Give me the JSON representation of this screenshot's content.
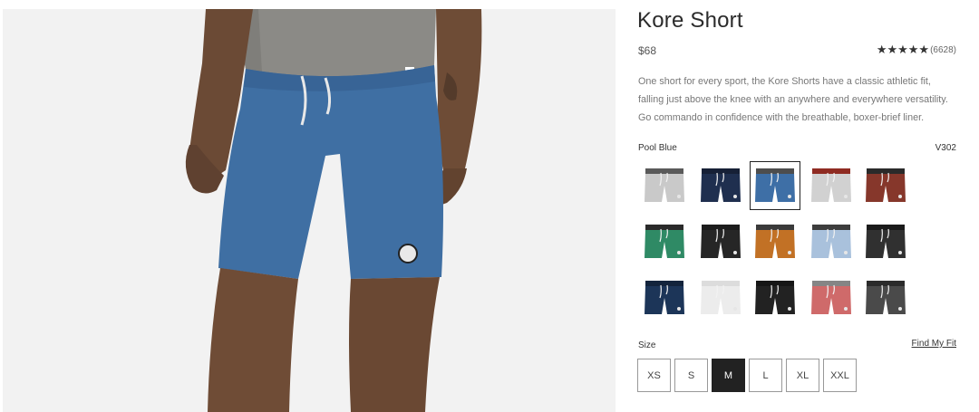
{
  "product": {
    "title": "Kore Short",
    "price": "$68",
    "rating_stars": "★★★★★",
    "review_count": "(6628)",
    "description": [
      "One short for every sport, the Kore Shorts have a classic athletic fit,",
      "falling just above the knee with an anywhere and everywhere versatility.",
      "Go commando in confidence with the breathable, boxer-brief liner."
    ]
  },
  "color": {
    "selected_name": "Pool Blue",
    "sku": "V302",
    "swatches": [
      {
        "name": "heather-grey",
        "body": "#c9c9c9",
        "band": "#5a5a5a",
        "selected": false
      },
      {
        "name": "navy-camo",
        "body": "#1f2f4f",
        "band": "#162036",
        "selected": false
      },
      {
        "name": "pool-blue",
        "body": "#3e6fa6",
        "band": "#4d4d4d",
        "selected": true
      },
      {
        "name": "grey-red-band",
        "body": "#d1d1d1",
        "band": "#8f2b22",
        "selected": false
      },
      {
        "name": "brick",
        "body": "#86372b",
        "band": "#2a2a2a",
        "selected": false
      },
      {
        "name": "green",
        "body": "#2f8a65",
        "band": "#2a2a2a",
        "selected": false
      },
      {
        "name": "black",
        "body": "#262626",
        "band": "#1c1c1c",
        "selected": false
      },
      {
        "name": "rust",
        "body": "#c27125",
        "band": "#3a3a3a",
        "selected": false
      },
      {
        "name": "light-blue",
        "body": "#a9c1dc",
        "band": "#3d3d3d",
        "selected": false
      },
      {
        "name": "black-print",
        "body": "#303030",
        "band": "#1a1a1a",
        "selected": false
      },
      {
        "name": "deep-navy",
        "body": "#1c3558",
        "band": "#13243c",
        "selected": false
      },
      {
        "name": "white",
        "body": "#ececec",
        "band": "#dcdcdc",
        "selected": false
      },
      {
        "name": "black-2",
        "body": "#222222",
        "band": "#161616",
        "selected": false
      },
      {
        "name": "salmon",
        "body": "#cf6a6a",
        "band": "#858585",
        "selected": false
      },
      {
        "name": "charcoal",
        "body": "#4a4a4a",
        "band": "#2b2b2b",
        "selected": false
      }
    ]
  },
  "size": {
    "label": "Size",
    "fit_link": "Find My Fit",
    "options": [
      "XS",
      "S",
      "M",
      "L",
      "XL",
      "XXL"
    ],
    "selected": "M"
  }
}
